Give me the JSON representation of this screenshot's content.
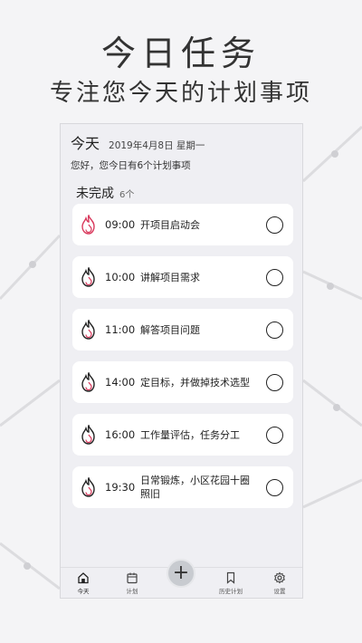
{
  "promo": {
    "title": "今日任务",
    "subtitle": "专注您今天的计划事项"
  },
  "header": {
    "title": "今天",
    "date": "2019年4月8日 星期一",
    "greeting": "您好，您今日有6个计划事项"
  },
  "section": {
    "title": "未完成",
    "count": "6个"
  },
  "tasks": [
    {
      "time": "09:00",
      "title": "开项目启动会",
      "icon": "flame-icon",
      "color": "#d8365a"
    },
    {
      "time": "10:00",
      "title": "讲解项目需求",
      "icon": "flame-icon",
      "color": "#222222"
    },
    {
      "time": "11:00",
      "title": "解答项目问题",
      "icon": "flame-icon",
      "color": "#222222"
    },
    {
      "time": "14:00",
      "title": "定目标，并做掉技术选型",
      "icon": "flame-icon",
      "color": "#222222"
    },
    {
      "time": "16:00",
      "title": "工作量评估，任务分工",
      "icon": "flame-icon",
      "color": "#222222"
    },
    {
      "time": "19:30",
      "title": "日常锻炼，小区花园十圈 照旧",
      "icon": "flame-icon",
      "color": "#222222"
    }
  ],
  "tabbar": {
    "tabs": [
      {
        "label": "今天",
        "icon": "home-icon",
        "active": true
      },
      {
        "label": "计划",
        "icon": "calendar-icon",
        "active": false
      },
      {
        "label": "历史计划",
        "icon": "bookmark-icon",
        "active": false
      },
      {
        "label": "设置",
        "icon": "gear-icon",
        "active": false
      }
    ],
    "add_label": "+"
  },
  "colors": {
    "accent": "#d8365a",
    "background": "#efeff3",
    "card": "#ffffff"
  }
}
